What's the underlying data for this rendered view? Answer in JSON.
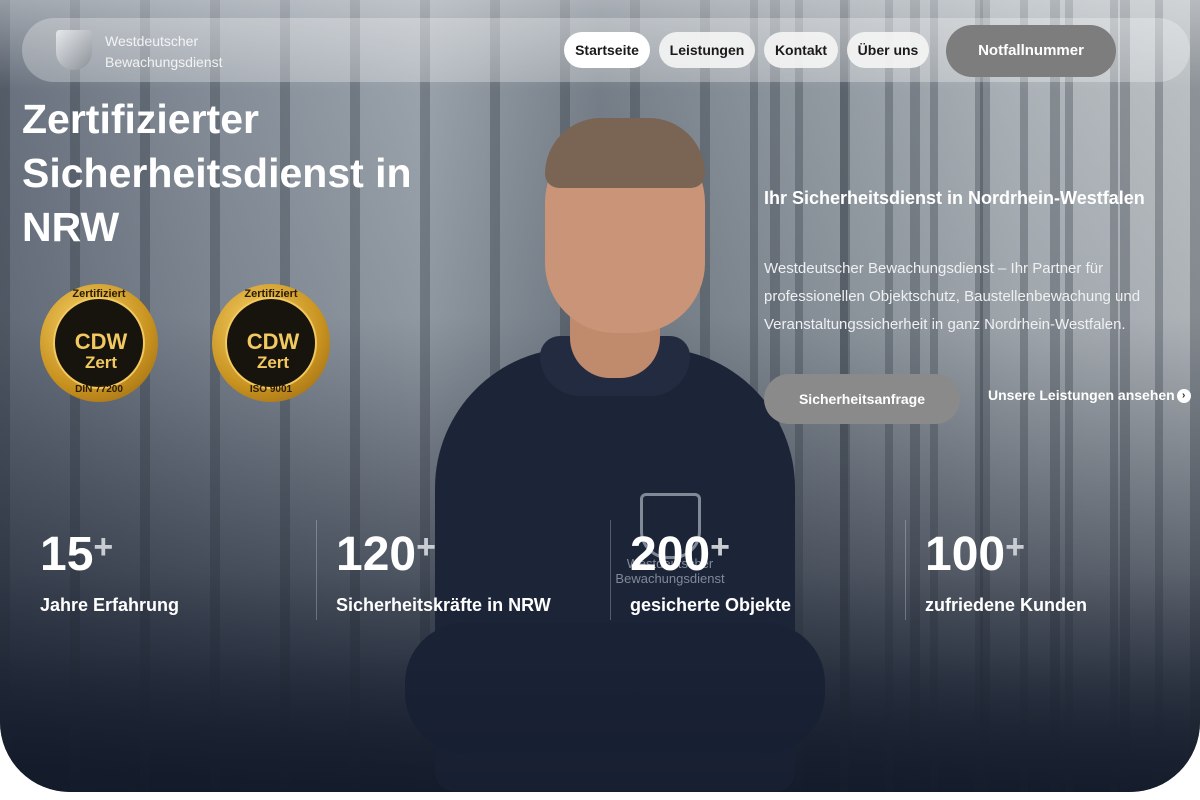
{
  "nav": {
    "logo_line1": "Westdeutscher",
    "logo_line2": "Bewachungsdienst",
    "links": [
      "Startseite",
      "Leistungen",
      "Kontakt",
      "Über uns"
    ],
    "emergency_label": "Notfallnummer"
  },
  "hero": {
    "headline": "Zertifizierter Sicherheitsdienst in NRW",
    "badges": [
      {
        "top": "Zertifiziert",
        "main": "CDW",
        "sub": "Zert",
        "bottom": "DIN 77200"
      },
      {
        "top": "Zertifiziert",
        "main": "CDW",
        "sub": "Zert",
        "bottom": "ISO 9001"
      }
    ],
    "sub_title": "Ihr Sicherheitsdienst in Nordrhein-Westfalen",
    "description": "Westdeutscher Bewachungsdienst – Ihr Partner für professionellen Objektschutz, Baustellenbewachung und Veranstaltungssicherheit in ganz Nordrhein-Westfalen.",
    "cta_label": "Sicherheitsanfrage",
    "services_link": "Unsere Leistungen ansehen",
    "shirt_text": "Westdeutscher Bewachungsdienst"
  },
  "stats": [
    {
      "value": "15",
      "plus": "+",
      "label": "Jahre Erfahrung"
    },
    {
      "value": "120",
      "plus": "+",
      "label": "Sicherheitskräfte in NRW"
    },
    {
      "value": "200",
      "plus": "+",
      "label": "gesicherte Objekte"
    },
    {
      "value": "100",
      "plus": "+",
      "label": "zufriedene Kunden"
    }
  ],
  "icons": {
    "logo": "shield-icon",
    "arrow": "arrow-right-circle-icon"
  }
}
